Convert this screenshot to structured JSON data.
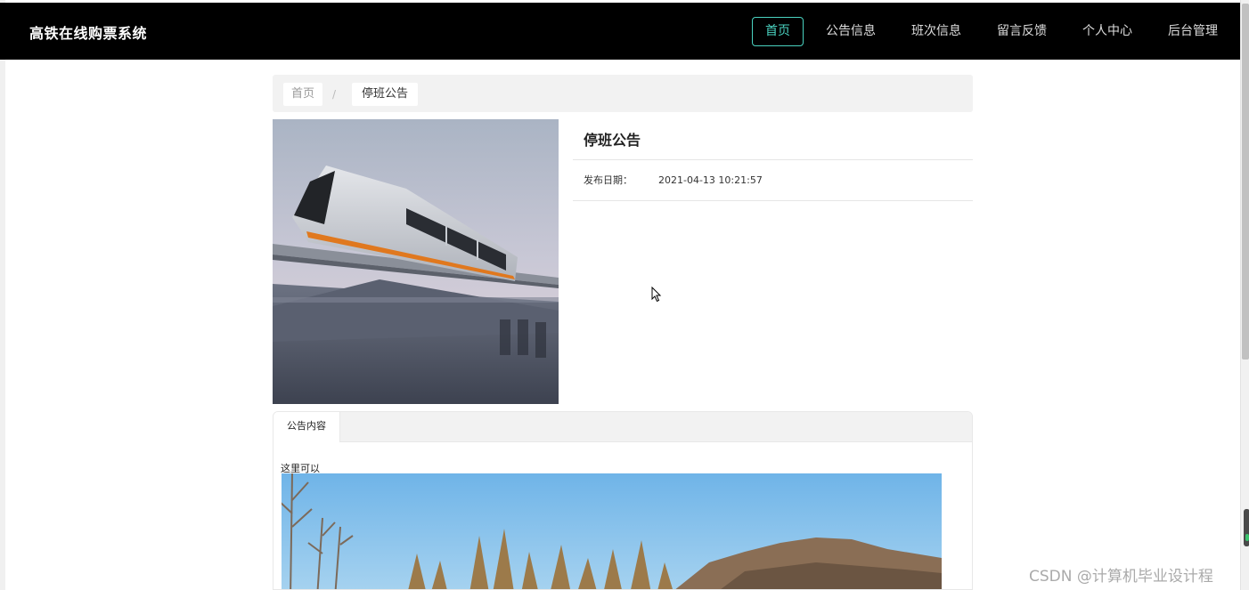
{
  "header": {
    "brand": "高铁在线购票系统",
    "nav": [
      "首页",
      "公告信息",
      "班次信息",
      "留言反馈",
      "个人中心",
      "后台管理"
    ],
    "active_nav": "首页"
  },
  "breadcrumb": {
    "home": "首页",
    "separator": "/",
    "current": "停班公告"
  },
  "notice": {
    "title": "停班公告",
    "date_label": "发布日期：",
    "date_value": "2021-04-13 10:21:57"
  },
  "tabs": {
    "active": "公告内容"
  },
  "content": {
    "text": "这里可以"
  },
  "watermark": "CSDN @计算机毕业设计程",
  "colors": {
    "header_bg": "#000000",
    "accent": "#4ad2c0",
    "breadcrumb_bg": "#f2f2f2"
  }
}
